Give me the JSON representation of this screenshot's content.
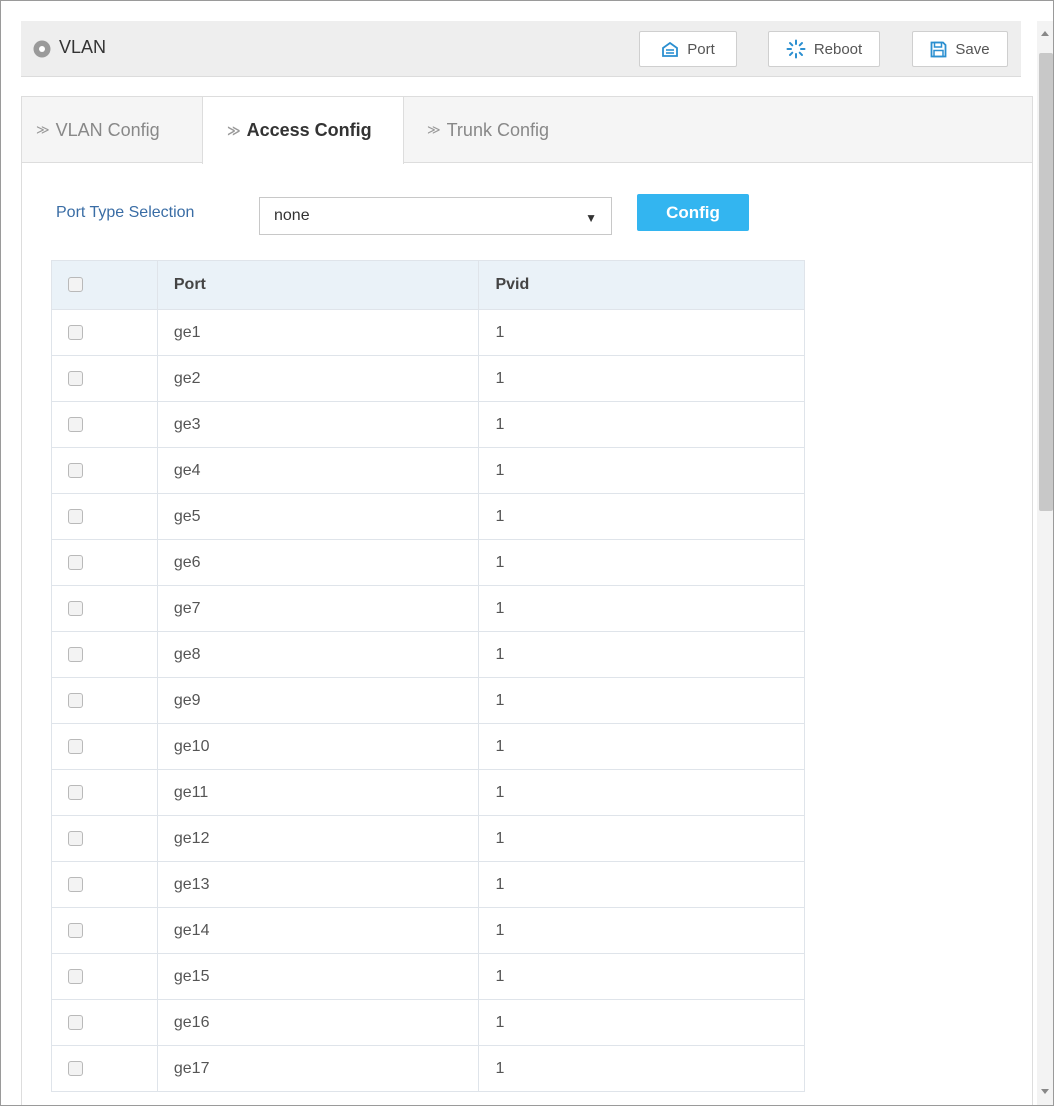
{
  "header": {
    "title": "VLAN",
    "buttons": {
      "port": "Port",
      "reboot": "Reboot",
      "save": "Save"
    }
  },
  "tabs": [
    {
      "label": "VLAN Config",
      "active": false
    },
    {
      "label": "Access Config",
      "active": true
    },
    {
      "label": "Trunk Config",
      "active": false
    }
  ],
  "port_type": {
    "label": "Port Type Selection",
    "selected": "none",
    "config_button": "Config"
  },
  "table": {
    "headers": {
      "port": "Port",
      "pvid": "Pvid"
    },
    "rows": [
      {
        "port": "ge1",
        "pvid": "1"
      },
      {
        "port": "ge2",
        "pvid": "1"
      },
      {
        "port": "ge3",
        "pvid": "1"
      },
      {
        "port": "ge4",
        "pvid": "1"
      },
      {
        "port": "ge5",
        "pvid": "1"
      },
      {
        "port": "ge6",
        "pvid": "1"
      },
      {
        "port": "ge7",
        "pvid": "1"
      },
      {
        "port": "ge8",
        "pvid": "1"
      },
      {
        "port": "ge9",
        "pvid": "1"
      },
      {
        "port": "ge10",
        "pvid": "1"
      },
      {
        "port": "ge11",
        "pvid": "1"
      },
      {
        "port": "ge12",
        "pvid": "1"
      },
      {
        "port": "ge13",
        "pvid": "1"
      },
      {
        "port": "ge14",
        "pvid": "1"
      },
      {
        "port": "ge15",
        "pvid": "1"
      },
      {
        "port": "ge16",
        "pvid": "1"
      },
      {
        "port": "ge17",
        "pvid": "1"
      }
    ]
  },
  "colors": {
    "accent": "#33b5f0",
    "label_blue": "#3a6da5",
    "header_bg": "#eeeeee",
    "table_header_bg": "#eaf2f8"
  },
  "icons": {
    "title": "location-pin-icon",
    "port": "port-icon",
    "reboot": "spinner-icon",
    "save": "floppy-disk-icon"
  }
}
